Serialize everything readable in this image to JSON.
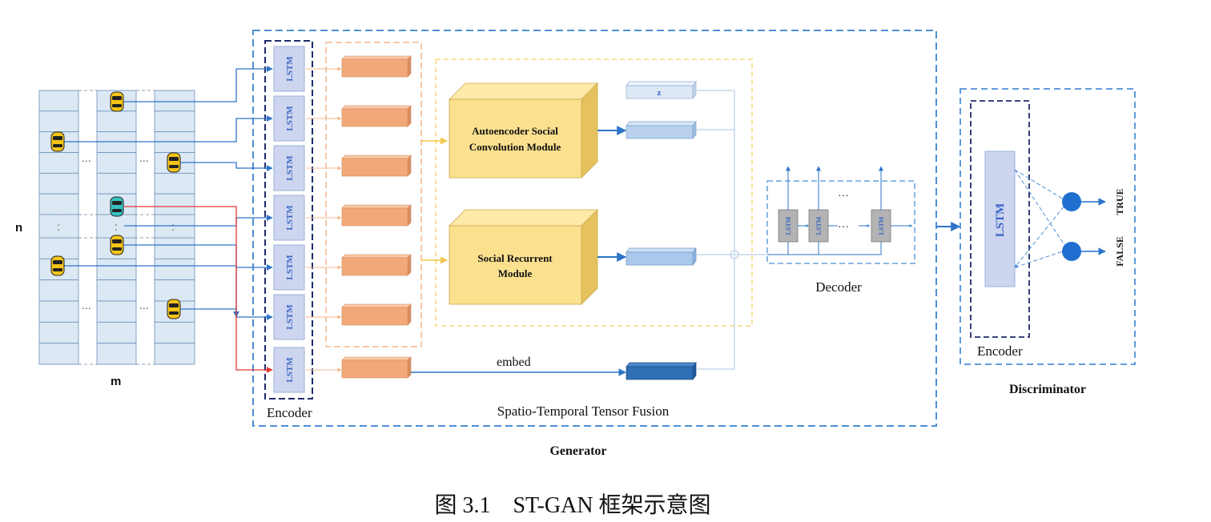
{
  "grid": {
    "label_n": "n",
    "label_m": "m",
    "ellipsis_h": "...",
    "ellipsis_v": ":"
  },
  "encoder": {
    "cell_label": "LSTM",
    "caption": "Encoder"
  },
  "z_label": "z",
  "modules": {
    "autoencoder": [
      "Autoencoder Social",
      "Convolution Module"
    ],
    "recurrent": [
      "Social Recurrent",
      "Module"
    ]
  },
  "embed_label": "embed",
  "fusion_caption": "Spatio-Temporal Tensor Fusion",
  "decoder": {
    "cell_label": "LSTM",
    "caption": "Decoder",
    "dots": "···"
  },
  "generator_caption": "Generator",
  "discriminator": {
    "lstm_label": "LSTM",
    "encoder_caption": "Encoder",
    "true_label": "TRUE",
    "false_label": "FALSE",
    "caption": "Discriminator"
  },
  "figure_caption": "图 3.1    ST-GAN 框架示意图",
  "colors": {
    "lane_fill": "#dce8f4",
    "lane_stroke": "#6a8fb8",
    "lstm_fill": "#cdd5ef",
    "lstm_text": "#3a66c4",
    "orange": "#f2a97a",
    "module_fill": "#fbe08e",
    "blue_arrow": "#2e74c9",
    "red_arrow": "#e53935",
    "node_blue": "#1f6fd0",
    "dark_dash": "#1f2a6b",
    "light_dash": "#4d8fd6",
    "embed_bar": "#2e6fb5"
  }
}
